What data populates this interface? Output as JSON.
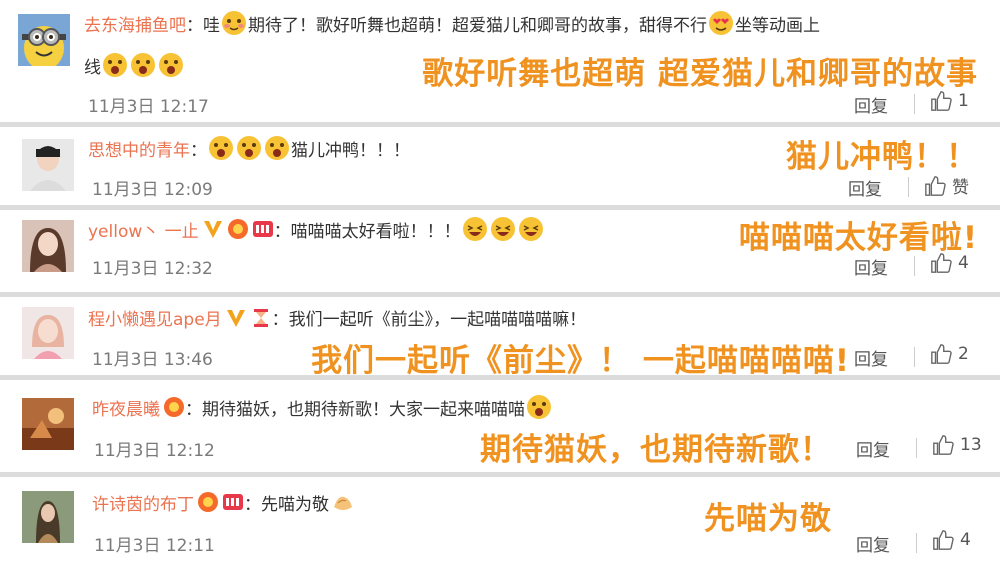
{
  "colors": {
    "username": "#eb7350",
    "overlay_text": "#f0921f",
    "divider": "#dcdcdc",
    "meta_text": "#7a7a7a"
  },
  "comments": [
    {
      "username": "去东海捕鱼吧",
      "text_1": "：哇",
      "text_2": "期待了！歌好听舞也超萌！超爱猫儿和卿哥的故事，甜得不行",
      "text_3": "坐等动画上",
      "text_4": "线",
      "time": "11月3日 12:17",
      "reply": "回复",
      "likes": "1",
      "overlay": "歌好听舞也超萌 超爱猫儿和卿哥的故事",
      "avatar_icon": "minion-avatar"
    },
    {
      "username": "思想中的青年",
      "text_1": "：",
      "text_2": "猫儿冲鸭！！！",
      "time": "11月3日 12:09",
      "reply": "回复",
      "likes": "赞",
      "overlay": "猫儿冲鸭！！",
      "avatar_icon": "person-avatar"
    },
    {
      "username": "yellow丶 一止",
      "text_1": "：喵喵喵太好看啦！！！",
      "time": "11月3日 12:32",
      "reply": "回复",
      "likes": "4",
      "overlay": "喵喵喵太好看啦!",
      "avatar_icon": "girl-avatar"
    },
    {
      "username": "程小懒遇见ape月",
      "text_1": "：我们一起听《前尘》，一起喵喵喵喵嘛！",
      "time": "11月3日 13:46",
      "reply": "回复",
      "likes": "2",
      "overlay": "我们一起听《前尘》！ 一起喵喵喵喵!",
      "avatar_icon": "girl-avatar-2"
    },
    {
      "username": "昨夜晨曦",
      "text_1": "：期待猫妖，也期待新歌！大家一起来喵喵喵",
      "time": "11月3日 12:12",
      "reply": "回复",
      "likes": "13",
      "overlay": "期待猫妖，也期待新歌！",
      "avatar_icon": "scene-avatar"
    },
    {
      "username": "许诗茵的布丁",
      "text_1": "：先喵为敬",
      "time": "11月3日 12:11",
      "reply": "回复",
      "likes": "4",
      "overlay": "先喵为敬",
      "avatar_icon": "portrait-avatar"
    }
  ]
}
